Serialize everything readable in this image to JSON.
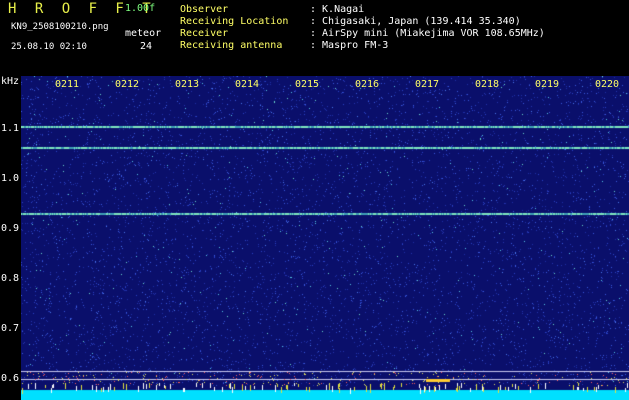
{
  "header": {
    "brand": "H R O F F T",
    "version": "1.00f",
    "filename": "KN9_2508100210.png",
    "meteor_label": "meteor",
    "timestamp": "25.08.10 02:10",
    "meteor_count": "24",
    "info": [
      {
        "key": "Observer",
        "value": ": K.Nagai"
      },
      {
        "key": "Receiving Location",
        "value": ": Chigasaki, Japan (139.414 35.340)"
      },
      {
        "key": "Receiver",
        "value": ": AirSpy mini (Miakejima VOR 108.65MHz)"
      },
      {
        "key": "Receiving antenna",
        "value": ": Maspro FM-3"
      }
    ]
  },
  "spectrogram": {
    "unit_label": "kHz",
    "y_ticks": [
      "1.1",
      "1.0",
      "0.9",
      "0.8",
      "0.7",
      "0.6"
    ],
    "time_ticks": [
      "0211",
      "0212",
      "0213",
      "0214",
      "0215",
      "0216",
      "0217",
      "0218",
      "0219",
      "0220"
    ],
    "background_color": "#0a0f6b",
    "baseline_color": "#00e0ff",
    "trace_color": "#7fe8c0"
  }
}
